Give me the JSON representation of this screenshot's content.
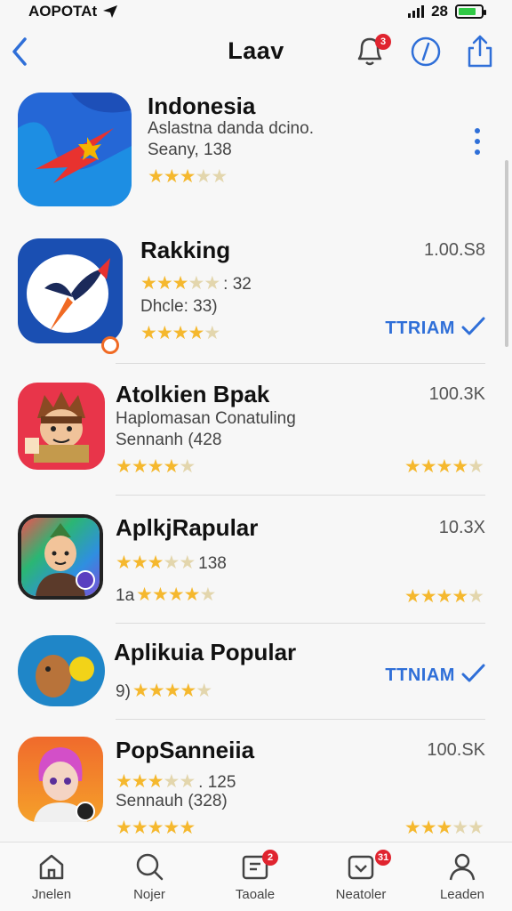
{
  "status": {
    "carrier": "AOPOTAt",
    "time": "28",
    "battery_level": 0.8
  },
  "header": {
    "title": "Laav",
    "notifications_badge": "3"
  },
  "apps": [
    {
      "name": "Indonesia",
      "subtitle": "Aslastna danda dcino.",
      "line3": "Seany, 138",
      "rating": 3,
      "rating_label": "",
      "right_text": ""
    },
    {
      "name": "Rakking",
      "line_a_label": ": 32",
      "line_a_rating": 2.5,
      "subtitle": "Dhcle: 33)",
      "rating": 4,
      "right_text": "1.00.S8",
      "button": "TTRIAM"
    },
    {
      "name": "Atolkien Bpak",
      "subtitle": "Haplomasan Conatuling",
      "line3": "Sennanh (428",
      "rating": 4,
      "right_text": "100.3K",
      "right_rating": 4
    },
    {
      "name": "AplkjRapular",
      "line_a_label": "138",
      "line_a_rating": 3,
      "line_b_prefix": "1a",
      "rating": 4,
      "right_text": "10.3X",
      "right_rating": 4
    },
    {
      "name": "Aplikuia Popular",
      "line_b_prefix": "9)",
      "rating": 4,
      "button": "TTNIAM"
    },
    {
      "name": "PopSanneiia",
      "line_a_label": ". 125",
      "line_a_rating": 3,
      "subtitle": "Sennauh (328)",
      "rating": 5,
      "right_text": "100.SK",
      "right_rating": 3
    }
  ],
  "tabs": [
    {
      "label": "Jnelen",
      "icon": "home-icon"
    },
    {
      "label": "Nojer",
      "icon": "search-icon"
    },
    {
      "label": "Taoale",
      "icon": "apps-icon",
      "badge": "2"
    },
    {
      "label": "Neatoler",
      "icon": "updates-icon",
      "badge": "31"
    },
    {
      "label": "Leaden",
      "icon": "account-icon"
    }
  ],
  "colors": {
    "accent": "#2f6fd8",
    "star": "#f5b82e",
    "badge": "#e0242f"
  }
}
